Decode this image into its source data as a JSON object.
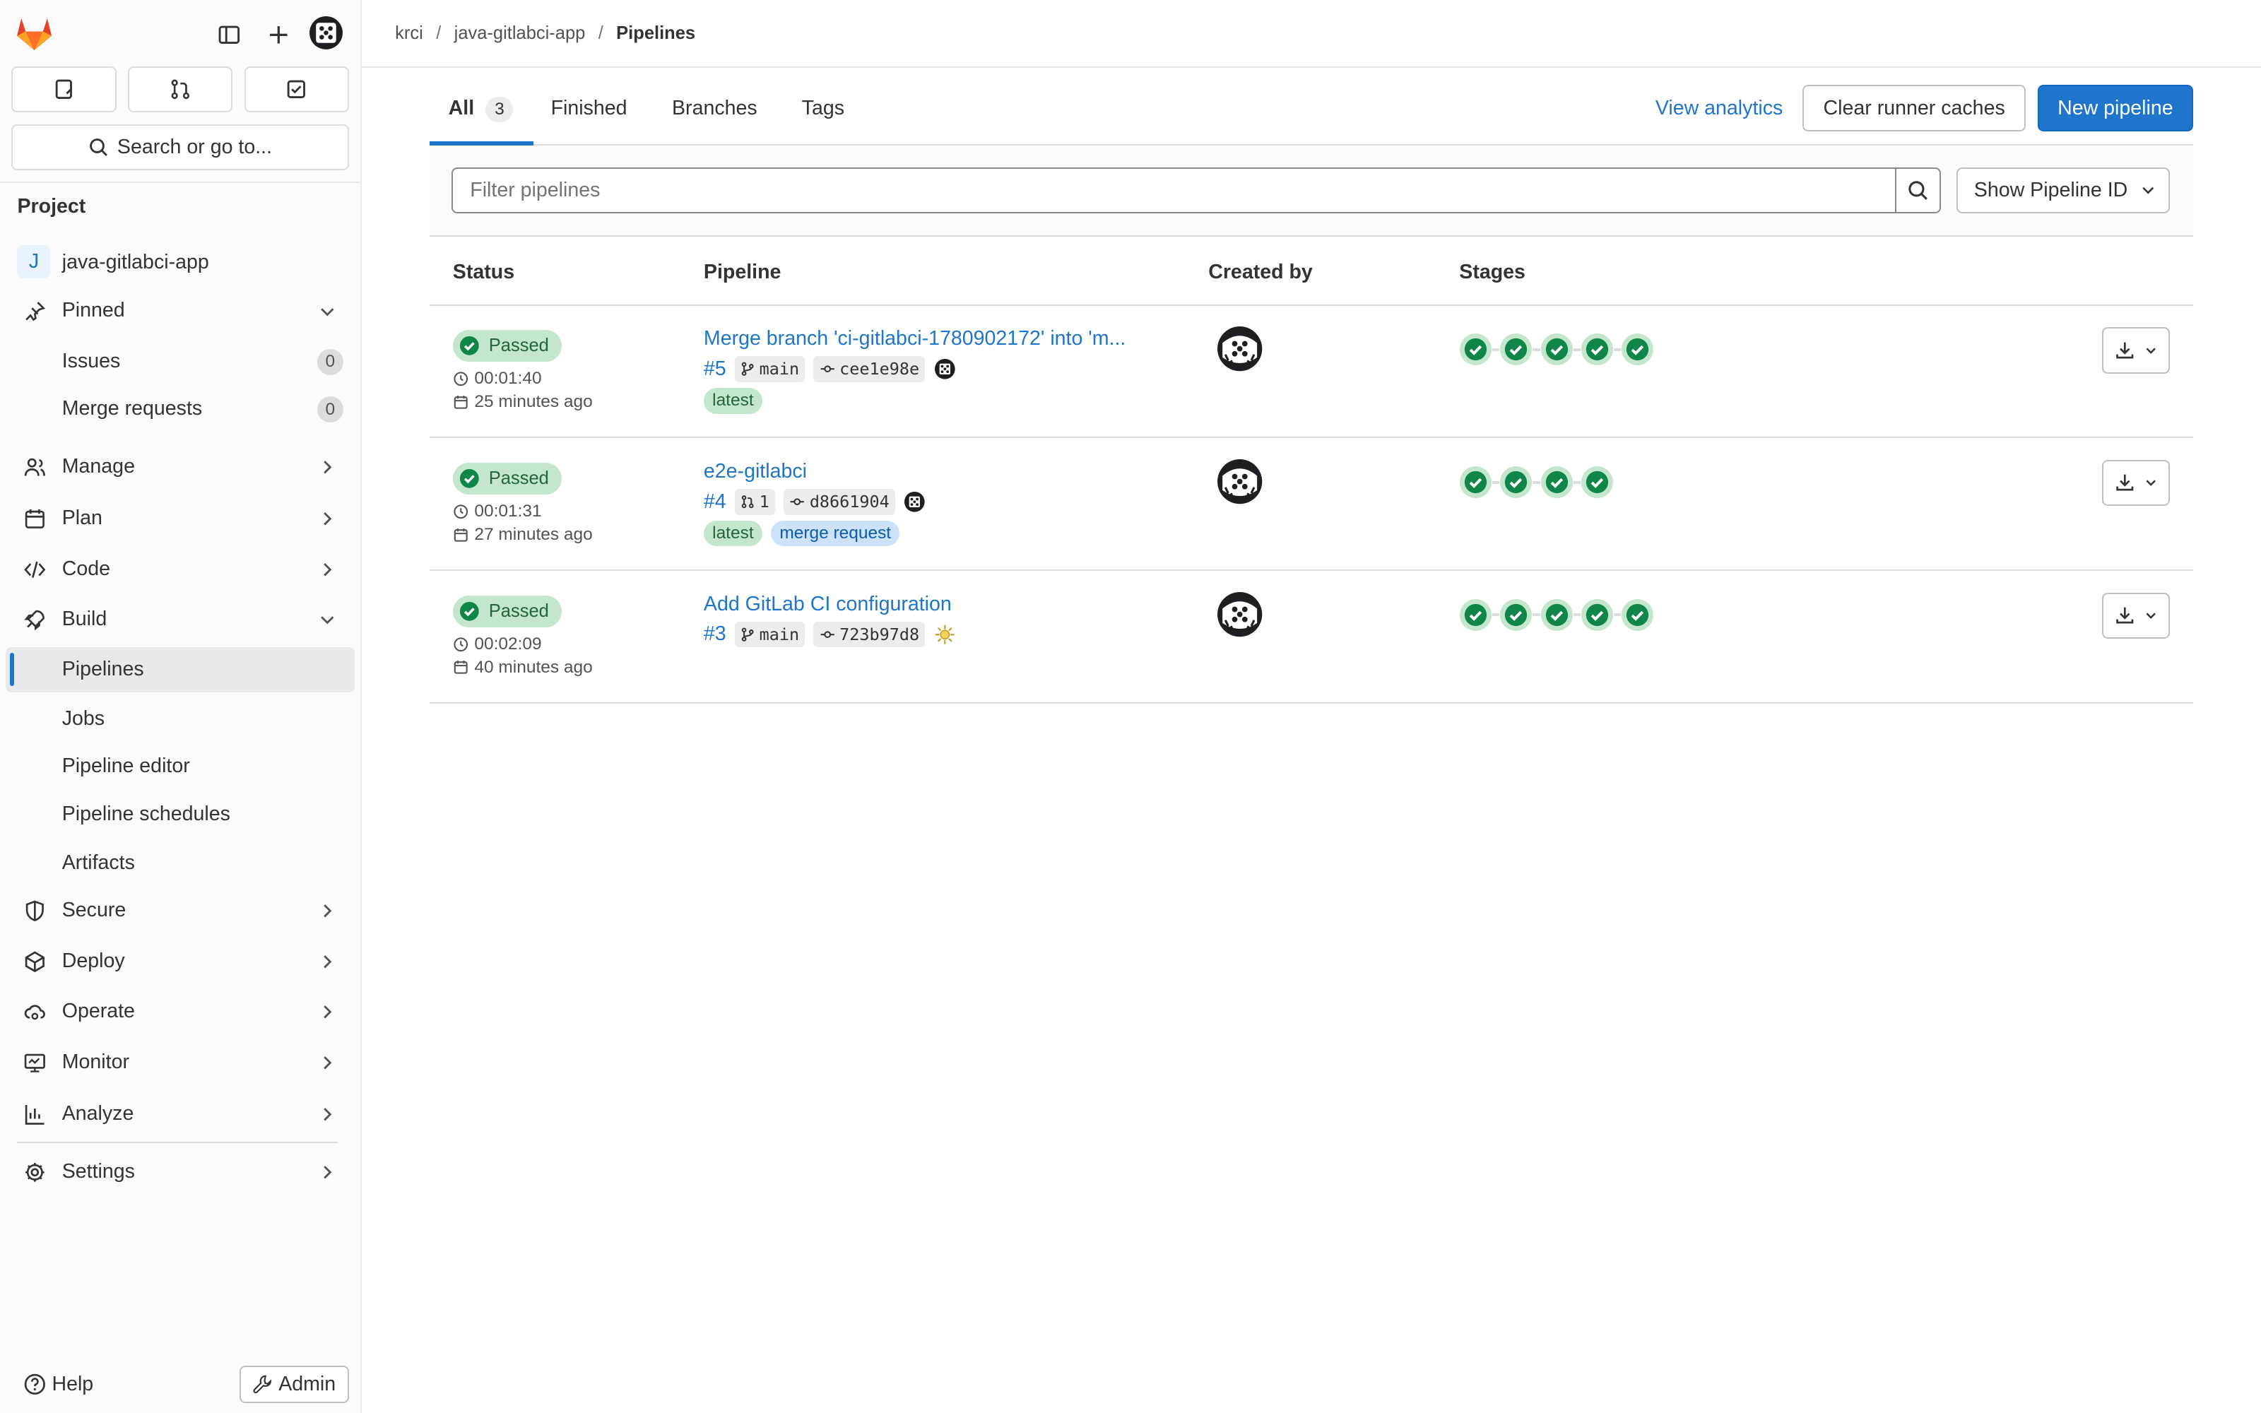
{
  "sidebar": {
    "search_label": "Search or go to...",
    "section_title": "Project",
    "project": {
      "initial": "J",
      "name": "java-gitlabci-app"
    },
    "pinned": {
      "label": "Pinned",
      "items": [
        {
          "label": "Issues",
          "count": "0"
        },
        {
          "label": "Merge requests",
          "count": "0"
        }
      ]
    },
    "groups": [
      {
        "label": "Manage"
      },
      {
        "label": "Plan"
      },
      {
        "label": "Code"
      },
      {
        "label": "Build"
      }
    ],
    "build_items": [
      "Pipelines",
      "Jobs",
      "Pipeline editor",
      "Pipeline schedules",
      "Artifacts"
    ],
    "groups_after": [
      {
        "label": "Secure"
      },
      {
        "label": "Deploy"
      },
      {
        "label": "Operate"
      },
      {
        "label": "Monitor"
      },
      {
        "label": "Analyze"
      }
    ],
    "settings_label": "Settings",
    "help_label": "Help",
    "admin_label": "Admin"
  },
  "breadcrumb": [
    "krci",
    "java-gitlabci-app",
    "Pipelines"
  ],
  "tabs": [
    {
      "label": "All",
      "count": "3"
    },
    {
      "label": "Finished"
    },
    {
      "label": "Branches"
    },
    {
      "label": "Tags"
    }
  ],
  "actions": {
    "view_analytics": "View analytics",
    "clear_caches": "Clear runner caches",
    "new_pipeline": "New pipeline"
  },
  "filter": {
    "placeholder": "Filter pipelines",
    "show_id": "Show Pipeline ID"
  },
  "table": {
    "headers": [
      "Status",
      "Pipeline",
      "Created by",
      "Stages"
    ],
    "rows": [
      {
        "status": "Passed",
        "duration": "00:01:40",
        "finished": "25 minutes ago",
        "title": "Merge branch 'ci-gitlabci-1780902172' into 'm...",
        "id": "#5",
        "ref": "main",
        "commit": "cee1e98e",
        "tags": [
          "latest"
        ],
        "stages": 5
      },
      {
        "status": "Passed",
        "duration": "00:01:31",
        "finished": "27 minutes ago",
        "title": "e2e-gitlabci",
        "id": "#4",
        "ref": "1",
        "commit": "d8661904",
        "tags": [
          "latest",
          "merge request"
        ],
        "stages": 4
      },
      {
        "status": "Passed",
        "duration": "00:02:09",
        "finished": "40 minutes ago",
        "title": "Add GitLab CI configuration",
        "id": "#3",
        "ref": "main",
        "commit": "723b97d8",
        "tags": [],
        "stages": 5
      }
    ]
  },
  "colors": {
    "accent": "#1f75cb",
    "success": "#108548",
    "success_bg": "#c3e6cd",
    "brand_orange": "#e24329"
  }
}
